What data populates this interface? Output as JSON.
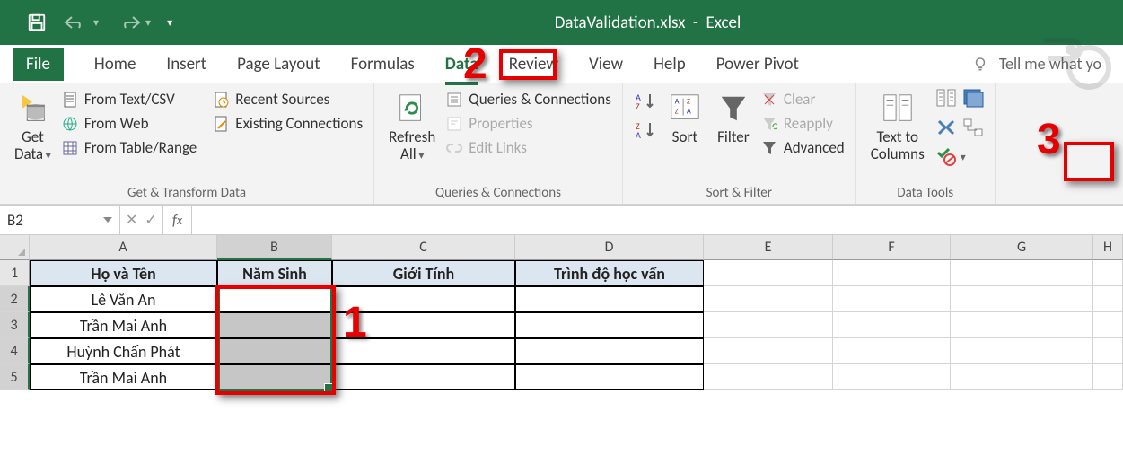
{
  "title": {
    "filename": "DataValidation.xlsx",
    "appname": "Excel"
  },
  "tabs": {
    "file": "File",
    "home": "Home",
    "insert": "Insert",
    "page_layout": "Page Layout",
    "formulas": "Formulas",
    "data": "Data",
    "review": "Review",
    "view": "View",
    "help": "Help",
    "power_pivot": "Power Pivot",
    "tell_me": "Tell me what yo"
  },
  "ribbon": {
    "get_data": {
      "label": "Get\nData",
      "group_label": "Get & Transform Data",
      "from_text_csv": "From Text/CSV",
      "from_web": "From Web",
      "from_table": "From Table/Range",
      "recent": "Recent Sources",
      "existing": "Existing Connections"
    },
    "qc": {
      "refresh": "Refresh\nAll",
      "group_label": "Queries & Connections",
      "queries": "Queries & Connections",
      "properties": "Properties",
      "edit_links": "Edit Links"
    },
    "sort": {
      "sort": "Sort",
      "filter": "Filter",
      "clear": "Clear",
      "reapply": "Reapply",
      "advanced": "Advanced",
      "group_label": "Sort & Filter"
    },
    "datatools": {
      "ttc": "Text to\nColumns",
      "group_label": "Data Tools"
    }
  },
  "namebox": "B2",
  "columns": [
    "A",
    "B",
    "C",
    "D",
    "E",
    "F",
    "G",
    "H"
  ],
  "rows": [
    "1",
    "2",
    "3",
    "4",
    "5"
  ],
  "headers": {
    "a": "Họ và Tên",
    "b": "Năm Sinh",
    "c": "Giới Tính",
    "d": "Trình độ học vấn"
  },
  "names": [
    "Lê Văn An",
    "Trần Mai Anh",
    "Huỳnh Chấn Phát",
    "Trần Mai Anh"
  ],
  "annotations": {
    "n1": "1",
    "n2": "2",
    "n3": "3"
  }
}
